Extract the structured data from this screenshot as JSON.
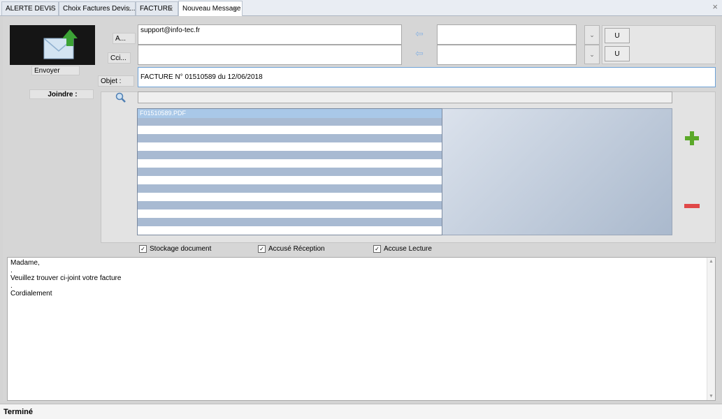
{
  "tabs": [
    {
      "label": "ALERTE DEVIS"
    },
    {
      "label": "Choix Factures Devis..."
    },
    {
      "label": "FACTURE"
    },
    {
      "label": "Nouveau Message"
    }
  ],
  "send": {
    "label": "Envoyer"
  },
  "recipients": {
    "to_label": "A...",
    "to_value": "support@info-tec.fr",
    "cci_label": "Cci...",
    "cci_value": "",
    "u_label": "U"
  },
  "subject": {
    "label": "Objet :",
    "value": "FACTURE N° 01510589 du 12/06/2018"
  },
  "attachments": {
    "label": "Joindre :",
    "files": [
      "F01510589.PDF"
    ]
  },
  "options": [
    {
      "label": "Stockage document",
      "checked": true
    },
    {
      "label": "Accusé Réception",
      "checked": true
    },
    {
      "label": "Accuse Lecture",
      "checked": true
    }
  ],
  "message": {
    "lines": [
      "Madame,",
      ".",
      "Veuillez trouver ci-joint votre facture",
      ".",
      "Cordialement"
    ]
  },
  "status": "Terminé",
  "colors": {
    "add": "#5aa829",
    "remove": "#e04848",
    "send_arrow": "#3ca336"
  }
}
